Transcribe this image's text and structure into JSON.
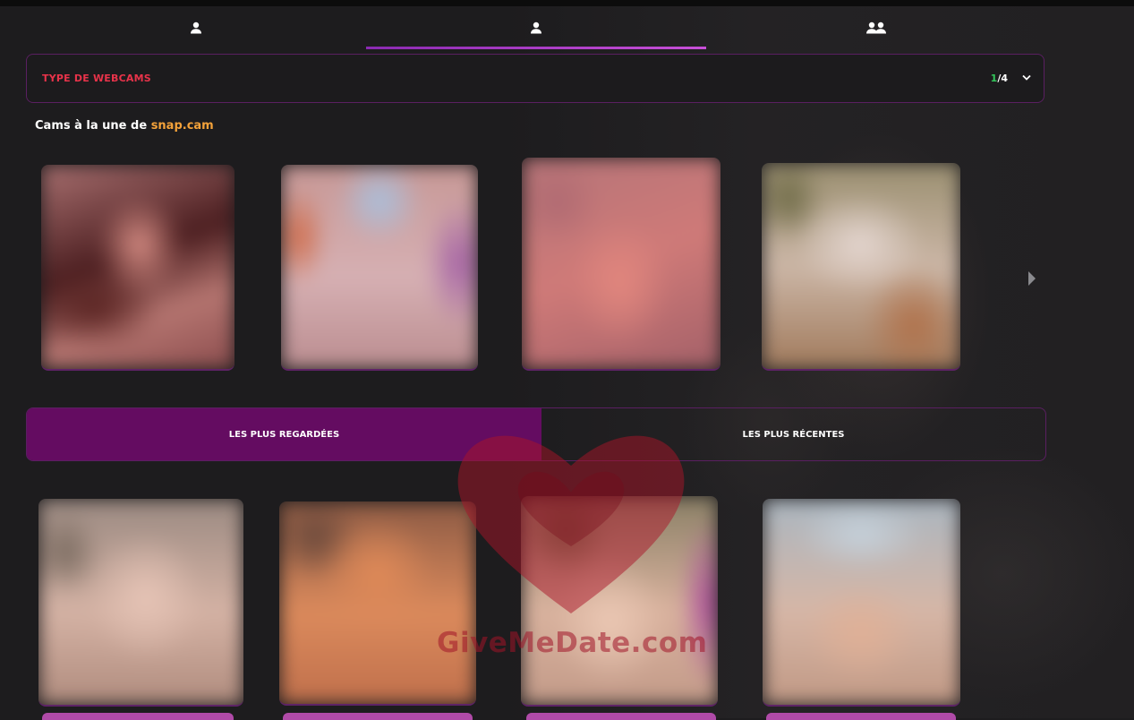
{
  "nav": {
    "tabs": [
      {
        "icon": "user-icon",
        "active": false
      },
      {
        "icon": "user-icon",
        "active": true
      },
      {
        "icon": "users-icon",
        "active": false
      }
    ]
  },
  "filter": {
    "label": "TYPE DE WEBCAMS",
    "page_current": "1",
    "page_sep": "/",
    "page_total": "4"
  },
  "featured": {
    "title_prefix": "Cams à la une de ",
    "brand": "snap.cam"
  },
  "sort": {
    "tabs": [
      {
        "label": "LES PLUS REGARDÉES",
        "active": true
      },
      {
        "label": "LES PLUS RÉCENTES",
        "active": false
      }
    ]
  },
  "watermark": {
    "text": "GiveMeDate.com"
  },
  "colors": {
    "accent": "#c84fd8",
    "active_tab": "#640c61",
    "label_red": "#e8334a",
    "brand_orange": "#f4a23a",
    "pager_green": "#33c65b"
  }
}
